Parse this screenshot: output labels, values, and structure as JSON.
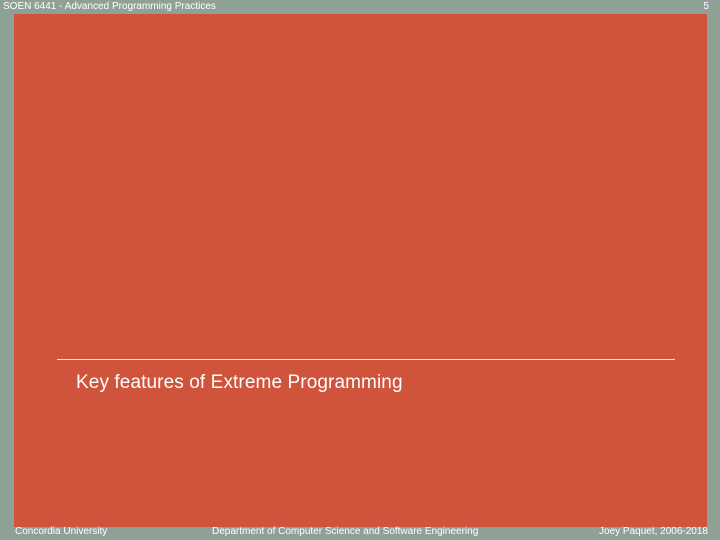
{
  "header": {
    "course": "SOEN 6441 - Advanced Programming Practices",
    "page_number": "5"
  },
  "slide": {
    "title": "Key features of Extreme Programming"
  },
  "footer": {
    "left": "Concordia University",
    "center": "Department of Computer Science and Software Engineering",
    "right": "Joey Paquet, 2006-2018"
  },
  "colors": {
    "background": "#8fa197",
    "slide_panel": "#cf543b",
    "text": "#ffffff"
  }
}
